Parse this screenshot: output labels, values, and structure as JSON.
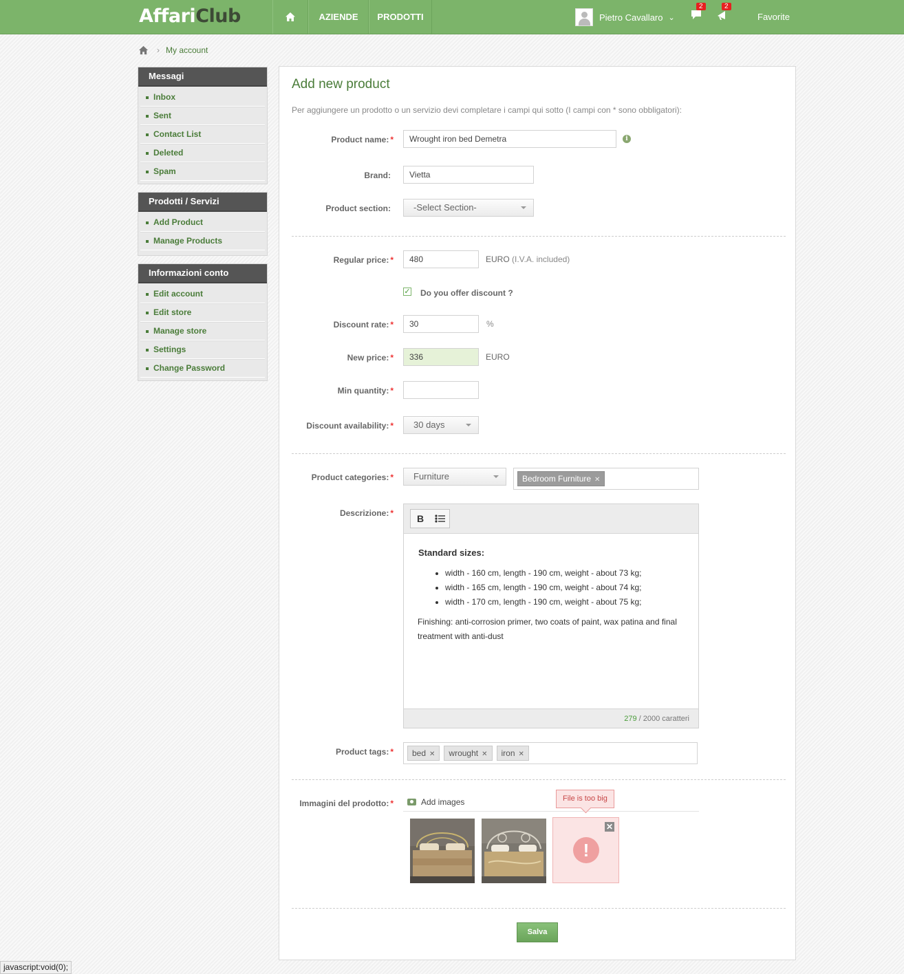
{
  "header": {
    "logo_a": "Affari",
    "logo_b": "Club",
    "nav": {
      "home_icon": "home-icon",
      "aziende": "AZIENDE",
      "prodotti": "PRODOTTI"
    },
    "user_name": "Pietro Cavallaro",
    "messages_count": "2",
    "notifications_count": "2",
    "favorite": "Favorite"
  },
  "breadcrumb": {
    "current": "My account"
  },
  "sidebar": {
    "messaggi": {
      "title": "Messagi",
      "items": [
        "Inbox",
        "Sent",
        "Contact List",
        "Deleted",
        "Spam"
      ]
    },
    "prodotti": {
      "title": "Prodotti / Servizi",
      "items": [
        "Add Product",
        "Manage Products"
      ]
    },
    "conto": {
      "title": "Informazioni conto",
      "items": [
        "Edit account",
        "Edit store",
        "Manage store",
        "Settings",
        "Change Password"
      ]
    }
  },
  "form": {
    "title": "Add new product",
    "intro": "Per aggiungere un prodotto o un servizio devi completare i campi qui sotto (I campi con * sono obbligatori):",
    "required_mark": "*",
    "product_name": {
      "label": "Product name:",
      "value": "Wrought iron bed Demetra"
    },
    "brand": {
      "label": "Brand:",
      "value": "Vietta"
    },
    "section": {
      "label": "Product section:",
      "value": "-Select Section-"
    },
    "regular_price": {
      "label": "Regular price:",
      "value": "480",
      "unit": "EURO",
      "unit_note": "(I.V.A. included)"
    },
    "discount_check": {
      "label": "Do you offer discount ?",
      "checked": true
    },
    "discount_rate": {
      "label": "Discount rate:",
      "value": "30",
      "unit": "%"
    },
    "new_price": {
      "label": "New price:",
      "value": "336",
      "unit": "EURO"
    },
    "min_quantity": {
      "label": "Min quantity:",
      "value": ""
    },
    "discount_availability": {
      "label": "Discount availability:",
      "value": "30 days"
    },
    "categories": {
      "label": "Product categories:",
      "value": "Furniture",
      "selected": [
        "Bedroom Furniture"
      ]
    },
    "description": {
      "label": "Descrizione:",
      "bold_btn": "B",
      "heading": "Standard sizes:",
      "bullets": [
        "width - 160 cm, length - 190 cm, weight - about 73 kg;",
        "width - 165 cm, length - 190 cm, weight - about 74 kg;",
        "width - 170 cm, length - 190 cm, weight - about 75 kg;"
      ],
      "finishing": "Finishing: anti-corrosion primer, two coats of paint, wax patina and final treatment with anti-dust",
      "char_count": "279",
      "char_limit": "/ 2000 caratteri"
    },
    "tags": {
      "label": "Product tags:",
      "items": [
        "bed",
        "wrought",
        "iron"
      ]
    },
    "images": {
      "label": "Immagini del prodotto:",
      "add_label": "Add images",
      "error_tooltip": "File is too big"
    },
    "save": "Salva"
  },
  "statusbar": "javascript:void(0);"
}
